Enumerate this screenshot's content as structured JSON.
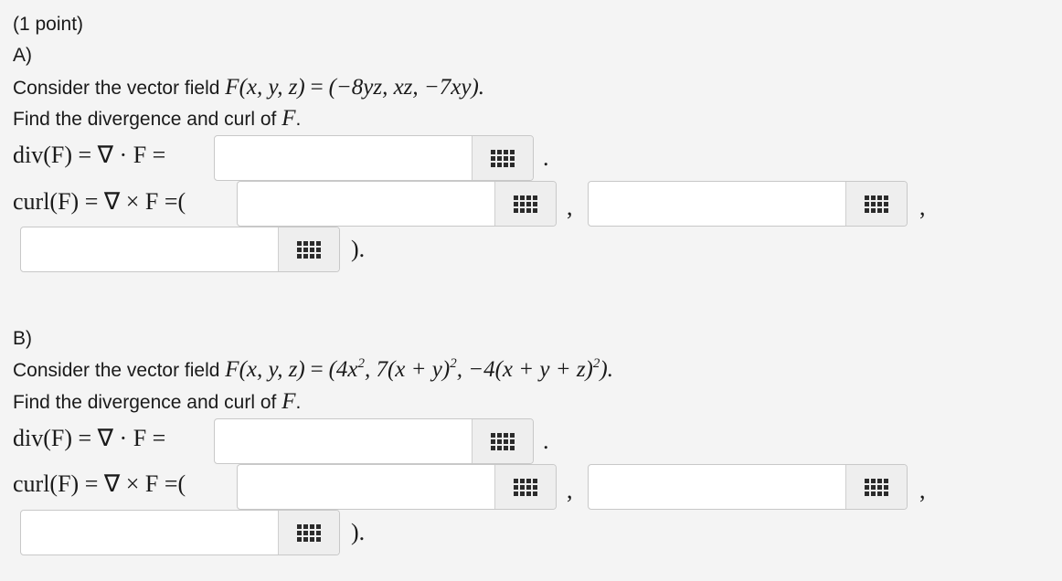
{
  "header": {
    "points": "(1 point)"
  },
  "partA": {
    "label": "A)",
    "intro": "Consider the vector field",
    "func": "F(x, y, z)",
    "eq": "=",
    "vec": "(−8yz, xz, −7xy).",
    "find": "Find the divergence and curl of",
    "find_var": "F",
    "find_end": ".",
    "div_label": "div(F) = ∇ · F =",
    "curl_label": "curl(F) = ∇ × F =(",
    "div_after": ".",
    "curl_sep1": ",",
    "curl_sep2": ",",
    "curl_end": ")."
  },
  "partB": {
    "label": "B)",
    "intro": "Consider the vector field",
    "func": "F(x, y, z)",
    "eq": "=",
    "vec_a": "(4x",
    "vec_a_exp": "2",
    "vec_b": ", 7(x + y)",
    "vec_b_exp": "2",
    "vec_c": ", −4(x + y + z)",
    "vec_c_exp": "2",
    "vec_d": ").",
    "find": "Find the divergence and curl of",
    "find_var": "F",
    "find_end": ".",
    "div_label": "div(F) = ∇ · F =",
    "curl_label": "curl(F) = ∇ × F =(",
    "div_after": ".",
    "curl_sep1": ",",
    "curl_sep2": ",",
    "curl_end": ")."
  },
  "inputs": {
    "a_div": "",
    "a_curl1": "",
    "a_curl2": "",
    "a_curl3": "",
    "b_div": "",
    "b_curl1": "",
    "b_curl2": "",
    "b_curl3": ""
  },
  "icons": {
    "palette": "equation-palette-icon"
  }
}
